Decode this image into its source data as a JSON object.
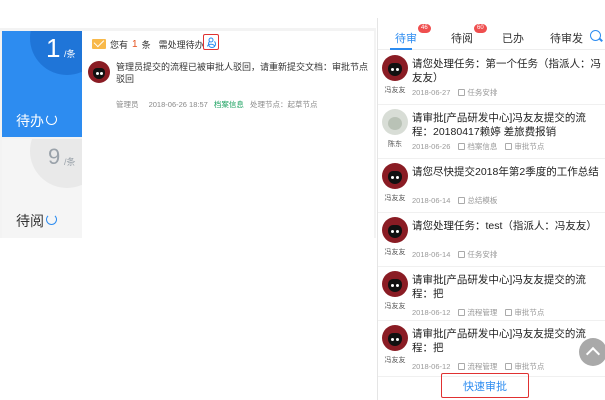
{
  "stats": {
    "todo": {
      "count": "1",
      "unit": "/条",
      "label": "待办"
    },
    "read": {
      "count": "9",
      "unit": "/条",
      "label": "待阅"
    }
  },
  "notice": {
    "prefix": "您有",
    "count": "1",
    "middle": "条",
    "suffix": "需处理待办"
  },
  "task": {
    "title": "管理员提交的流程已被审批人驳回，请重新提交文档：审批节点驳回",
    "sender": "管理员",
    "time": "2018-06-26 18:57",
    "tag": "档案信息",
    "node": "处理节点：起草节点"
  },
  "tabs": [
    {
      "label": "待审",
      "badge": "46",
      "active": true
    },
    {
      "label": "待阅",
      "badge": "60",
      "active": false
    },
    {
      "label": "已办",
      "badge": "",
      "active": false
    },
    {
      "label": "待审发文",
      "badge": "",
      "active": false
    }
  ],
  "approvals": [
    {
      "avatar": "cartoon",
      "name": "冯友友",
      "title": "请您处理任务：第一个任务（指派人：冯友友）",
      "date": "2018-06-27",
      "cat": "任务安排",
      "node": ""
    },
    {
      "avatar": "gray",
      "name": "陈东",
      "title": "请审批[产品研发中心]冯友友提交的流程：20180417赖婷 差旅费报销",
      "date": "2018-06-26",
      "cat": "档案信息",
      "node": "审批节点"
    },
    {
      "avatar": "cartoon",
      "name": "冯友友",
      "title": "请您尽快提交2018年第2季度的工作总结",
      "date": "2018-06-14",
      "cat": "总结模板",
      "node": ""
    },
    {
      "avatar": "cartoon",
      "name": "冯友友",
      "title": "请您处理任务：test（指派人：冯友友）",
      "date": "2018-06-14",
      "cat": "任务安排",
      "node": ""
    },
    {
      "avatar": "cartoon",
      "name": "冯友友",
      "title": "请审批[产品研发中心]冯友友提交的流程：把",
      "date": "2018-06-12",
      "cat": "流程管理",
      "node": "审批节点"
    },
    {
      "avatar": "cartoon",
      "name": "冯友友",
      "title": "请审批[产品研发中心]冯友友提交的流程：把",
      "date": "2018-06-12",
      "cat": "流程管理",
      "node": "审批节点"
    }
  ],
  "fast_approve": "快速审批",
  "colors": {
    "accent": "#2d8cf0",
    "highlight_border": "#e03131",
    "badge": "#ef4f4f"
  }
}
